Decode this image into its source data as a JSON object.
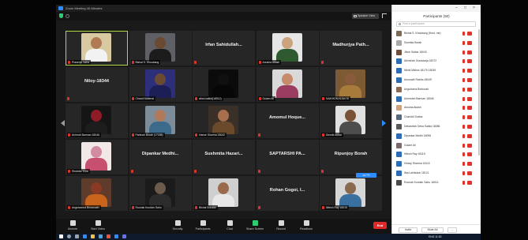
{
  "window": {
    "title": "Zoom Meeting 40-Minutes"
  },
  "top_bar": {
    "view_button": "Speaker View"
  },
  "tiles": [
    {
      "name": "",
      "caption": "Prasenjit Saha",
      "video": true,
      "active": true,
      "skin": "#b07a55",
      "shirt": "#f2f2f2",
      "bg": "#d8c9a0"
    },
    {
      "name": "",
      "caption": "Bishal S. Khoubang",
      "video": true,
      "skin": "#6a4a32",
      "shirt": "#1c1c1c",
      "bg": "#5f6066"
    },
    {
      "name": "Irfan Sahidullah...",
      "caption": "",
      "video": false
    },
    {
      "name": "",
      "caption": "Anusha Akash",
      "video": true,
      "skin": "#c9a47f",
      "shirt": "#2f5a2f",
      "bg": "#e6e6e6"
    },
    {
      "name": "Madhurjya Path...",
      "caption": "",
      "video": false
    },
    {
      "name": "Niloy-18344",
      "caption": "",
      "video": false
    },
    {
      "name": "",
      "caption": "Chand Nahimal",
      "video": true,
      "skin": "#6b4a33",
      "shirt": "#1b1f55",
      "bg": "#2d2f7a"
    },
    {
      "name": "",
      "caption": "abcd.saikid(18012)",
      "video": true,
      "skin": "#101010",
      "shirt": "#060606",
      "bg": "#0b0b0b"
    },
    {
      "name": "",
      "caption": "Gulam Ali",
      "video": true,
      "skin": "#c78a6a",
      "shirt": "#9a3d60",
      "bg": "#d9d9d9"
    },
    {
      "name": "",
      "caption": "SAIKHOM Ai Ani Ki",
      "video": true,
      "skin": "#8a5a3c",
      "shirt": "#a77c3a",
      "bg": "#7c5b34"
    },
    {
      "name": "",
      "caption": "Anirnob Barman 18046",
      "video": true,
      "skin": "#8d1c26",
      "shirt": "#1d1d1d",
      "bg": "#151515"
    },
    {
      "name": "",
      "caption": "Paritosh Borah (17038)",
      "video": true,
      "skin": "#b07a5a",
      "shirt": "#3b6a8a",
      "bg": "#7c8d99"
    },
    {
      "name": "",
      "caption": "Hanse Sharma 18042",
      "video": true,
      "skin": "#a76f4e",
      "shirt": "#6a4a2a",
      "bg": "#3b3027"
    },
    {
      "name": "Amomul Hoque...",
      "caption": "",
      "video": false
    },
    {
      "name": "",
      "caption": "Dimnik Akbar",
      "video": true,
      "skin": "#7a5236",
      "shirt": "#4d4d4d",
      "bg": "#e0e0e0"
    },
    {
      "name": "",
      "caption": "Shubdal Yulia",
      "video": true,
      "skin": "#d28ba0",
      "shirt": "#c6506d",
      "bg": "#f3e8e8"
    },
    {
      "name": "Dipankar Medhi...",
      "caption": "",
      "video": false
    },
    {
      "name": "Sushmita Hazari...",
      "caption": "",
      "video": false
    },
    {
      "name": "SAPTARSHI PA...",
      "caption": "",
      "video": false
    },
    {
      "name": "Ripunjoy Borah",
      "caption": "",
      "video": false
    },
    {
      "name": "",
      "caption": "Angshumna Bimarnath",
      "video": true,
      "skin": "#8a3a24",
      "shirt": "#c8641c",
      "bg": "#5e3b2a"
    },
    {
      "name": "",
      "caption": "Rounak Kundan Sahu",
      "video": true,
      "skin": "#6c5b4a",
      "shirt": "#2c2c2c",
      "bg": "#1b1b1b"
    },
    {
      "name": "",
      "caption": "Bishal Sonalal",
      "video": true,
      "skin": "#9a6a4a",
      "shirt": "#e8e8e8",
      "bg": "#cfcfcf"
    },
    {
      "name": "Rohan Gogoi, I...",
      "caption": "",
      "video": false
    },
    {
      "name": "",
      "caption": "Nitesh Ray 18015",
      "video": true,
      "skin": "#8a6a4f",
      "shirt": "#3a70a0",
      "bg": "#d6d6d6"
    }
  ],
  "page_indicator": "1/2 ⁿᵃᵍᵉ",
  "toolbar": {
    "buttons": [
      {
        "label": "Unmute",
        "icon": "microphone-icon",
        "color": "#d8d8d8"
      },
      {
        "label": "Start Video",
        "icon": "video-camera-icon",
        "color": "#d8d8d8"
      },
      {
        "label": "Security",
        "icon": "shield-icon",
        "color": "#d8d8d8"
      },
      {
        "label": "Participants",
        "icon": "participants-icon",
        "color": "#d8d8d8"
      },
      {
        "label": "Chat",
        "icon": "chat-icon",
        "color": "#d8d8d8"
      },
      {
        "label": "Share Screen",
        "icon": "share-screen-icon",
        "color": "#2ecc71"
      },
      {
        "label": "Record",
        "icon": "record-icon",
        "color": "#d8d8d8"
      },
      {
        "label": "Reactions",
        "icon": "reactions-icon",
        "color": "#d8d8d8"
      }
    ],
    "end": "End"
  },
  "participants_panel": {
    "title": "Participants (50)",
    "search_placeholder": "Find a participant",
    "items": [
      {
        "name": "Bishal S. Khoubang (Host, me)",
        "color": "#7b6a5a"
      },
      {
        "name": "Susmita Borah",
        "color": "#a9a9a9"
      },
      {
        "name": "Jibon Saikia 18043",
        "color": "#6d4f3a"
      },
      {
        "name": "Abhishek Gunadarja 18072",
        "color": "#2d6cb5"
      },
      {
        "name": "Nikhil Mishra 18175 18049",
        "color": "#2d6cb5"
      },
      {
        "name": "Amonath Rabha 18049",
        "color": "#2d6cb5"
      },
      {
        "name": "Angshuma Borborah",
        "color": "#8a6a55"
      },
      {
        "name": "Anirnobel Barman 18046",
        "color": "#2d6cb5"
      },
      {
        "name": "Anusha Akash",
        "color": "#c9a47f"
      },
      {
        "name": "Chandid Subba",
        "color": "#5a6a7a"
      },
      {
        "name": "Debashish Deka Saikia 18086",
        "color": "#5a5a5a"
      },
      {
        "name": "Dipankar Medhi 18096",
        "color": "#2d6cb5"
      },
      {
        "name": "Gulam Ali",
        "color": "#7a6a6a"
      },
      {
        "name": "Hitesh Ray 18115",
        "color": "#2d6cb5"
      },
      {
        "name": "Hriday Sharma 18110",
        "color": "#2d6cb5"
      },
      {
        "name": "Ifsa Lahikukar 18121",
        "color": "#2d6cb5"
      },
      {
        "name": "Rounak Kundan Sahu 18014",
        "color": "#4a4a4a"
      }
    ],
    "footer": {
      "invite": "Invite",
      "mute_all": "Mute All",
      "more": "..."
    }
  },
  "taskbar": {
    "clock": "ENG 11:52"
  }
}
